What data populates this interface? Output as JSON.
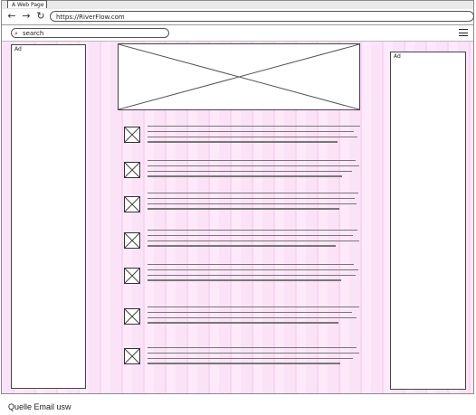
{
  "browser": {
    "tab_title": "A Web Page",
    "url": "https://RiverFlow.com",
    "search_placeholder": "search"
  },
  "page": {
    "ad_left_label": "Ad",
    "ad_right_label": "Ad",
    "content_rows": 7
  },
  "footer": {
    "caption": "Quelle Email usw"
  }
}
